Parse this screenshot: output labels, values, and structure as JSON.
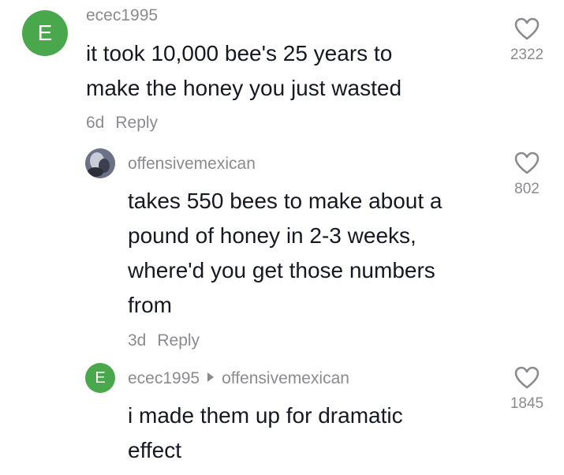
{
  "colors": {
    "avatar_green": "#4aa84c",
    "text_primary": "#161823",
    "text_secondary": "#8a8b91"
  },
  "comments": [
    {
      "username": "ecec1995",
      "avatar_letter": "E",
      "text": "it took 10,000 bee's 25 years to\nmake the honey you just wasted",
      "age": "6d",
      "reply_label": "Reply",
      "like_icon": "heart-outline-icon",
      "like_count": "2322"
    },
    {
      "username": "offensivemexican",
      "avatar": "photo-avatar",
      "text": "takes 550 bees to make about a\npound of honey in 2-3 weeks,\nwhere'd you get those numbers\nfrom",
      "age": "3d",
      "reply_label": "Reply",
      "like_icon": "heart-outline-icon",
      "like_count": "802"
    },
    {
      "username": "ecec1995",
      "reply_to": "offensivemexican",
      "avatar_letter": "E",
      "text": "i made them up for dramatic\neffect",
      "like_icon": "heart-outline-icon",
      "like_count": "1845"
    }
  ]
}
